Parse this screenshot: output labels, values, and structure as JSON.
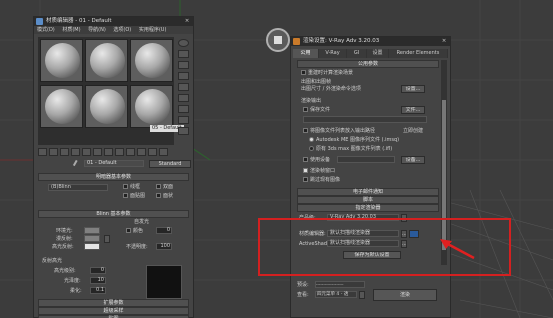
{
  "material_editor": {
    "title": "材质编辑器 - 01 - Default",
    "menu": [
      "模式(D)",
      "材质(M)",
      "导航(N)",
      "选项(O)",
      "实用程序(U)"
    ],
    "material_name": "01 - Default",
    "material_type": "Standard",
    "slot_tooltip": "05 - Default",
    "shader_section": "明暗器基本参数",
    "shader_value": "(B)Blinn",
    "shader_options": [
      "线框",
      "双面",
      "面贴图",
      "面状"
    ],
    "blinn_section": "Blinn 基本参数",
    "self_illum": "自发光",
    "color_label": "颜色",
    "color_value": "0",
    "opacity_label": "不透明度:",
    "opacity_value": "100",
    "ambient": "环境光:",
    "diffuse": "漫反射:",
    "specular": "高光反射:",
    "spec_highlights": "反射高光",
    "spec_level": "高光级别:",
    "glossiness": "光泽度:",
    "soften": "柔化:",
    "spec_level_value": "0",
    "glossiness_value": "10",
    "soften_value": "0.1",
    "rollouts": [
      "扩展参数",
      "超级采样",
      "贴图"
    ]
  },
  "render_setup": {
    "title": "渲染设置: V-Ray Adv 3.20.03",
    "tabs": [
      "公用",
      "V-Ray",
      "GI",
      "设置",
      "Render Elements"
    ],
    "common_params": "公用参数",
    "render_output_group": "渲染输出",
    "save_file": "保存文件",
    "files_button": "文件...",
    "render_to_seq": "出图和出图帧",
    "render_to_seq_detail": "出图尺寸 / 外渲染命令选项",
    "setup_button": "设置...",
    "put_image_file_list": "将图像文件列表放入输出路径",
    "create_now": "立即创建",
    "autodesk_me": "Autodesk ME 图像序列文件 (.imsq)",
    "legacy_3dsmax": "原有 3ds max 图像文件列表 (.ifl)",
    "use_device": "使用设备",
    "device_button": "设备...",
    "rendered_frame_window": "渲染帧窗口",
    "skip_existing": "跳过现有图像",
    "scene_state_top": "重建时计算渲染场景",
    "render_elements_rollout": "电子邮件通知",
    "script_rollout": "脚本",
    "assign_renderer": "指定渲染器",
    "product_label": "产品级:",
    "product_value": "V-Ray Adv 3.20.03",
    "material_editor_label": "材质编辑器:",
    "material_editor_value": "默认扫描线渲染器",
    "activeshade_label": "ActiveShade:",
    "activeshade_value": "默认扫描线渲染器",
    "save_as_defaults": "保存为默认设置",
    "preset_label": "预设:",
    "preset_value": "-------------------",
    "view_label": "查看:",
    "view_value": "四元菜单 4 - 透",
    "render_button": "渲染"
  },
  "colors": {
    "highlight": "#d42020",
    "arrow": "#e02020"
  }
}
